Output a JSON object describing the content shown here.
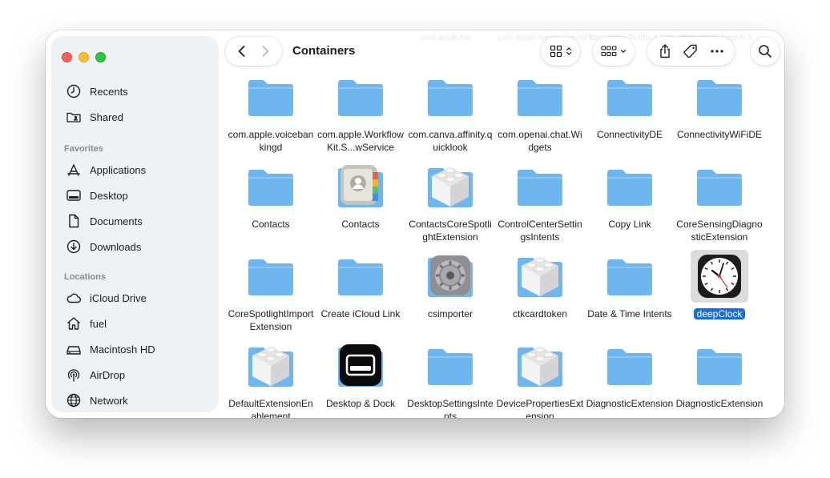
{
  "window": {
    "title": "Containers",
    "accent_color": "#1b6bd9",
    "folder_color": "#6fb6ee"
  },
  "sidebar": {
    "top_items": [
      {
        "label": "Recents",
        "icon": "clock-icon"
      },
      {
        "label": "Shared",
        "icon": "shared-folder-icon"
      }
    ],
    "favorites_heading": "Favorites",
    "favorites": [
      {
        "label": "Applications",
        "icon": "applications-icon"
      },
      {
        "label": "Desktop",
        "icon": "desktop-icon"
      },
      {
        "label": "Documents",
        "icon": "document-icon"
      },
      {
        "label": "Downloads",
        "icon": "download-icon"
      }
    ],
    "locations_heading": "Locations",
    "locations": [
      {
        "label": "iCloud Drive",
        "icon": "cloud-icon"
      },
      {
        "label": "fuel",
        "icon": "home-icon"
      },
      {
        "label": "Macintosh HD",
        "icon": "disk-icon"
      },
      {
        "label": "AirDrop",
        "icon": "airdrop-icon"
      },
      {
        "label": "Network",
        "icon": "globe-icon"
      }
    ]
  },
  "toolbar": {
    "ghost_names": [
      "com.apple.me",
      "com.apple.speec...rverXPC",
      "com.apple.TextIngit.Ser...stension",
      "com.apple.fpeech.S"
    ]
  },
  "files": [
    {
      "name": "com.apple.voicebankingd",
      "kind": "folder"
    },
    {
      "name": "com.apple.WorkflowKit.S...wService",
      "kind": "folder"
    },
    {
      "name": "com.canva.affinity.quicklook",
      "kind": "folder"
    },
    {
      "name": "com.openai.chat.Widgets",
      "kind": "folder"
    },
    {
      "name": "ConnectivityDE",
      "kind": "folder"
    },
    {
      "name": "ConnectivityWiFiDE",
      "kind": "folder"
    },
    {
      "name": "Contacts",
      "kind": "folder"
    },
    {
      "name": "Contacts",
      "kind": "contacts-app"
    },
    {
      "name": "ContactsCoreSpotlightExtension",
      "kind": "extension"
    },
    {
      "name": "ControlCenterSettingsIntents",
      "kind": "folder"
    },
    {
      "name": "Copy Link",
      "kind": "folder"
    },
    {
      "name": "CoreSensingDiagnosticExtension",
      "kind": "folder"
    },
    {
      "name": "CoreSpotlightImportExtension",
      "kind": "folder"
    },
    {
      "name": "Create iCloud Link",
      "kind": "folder"
    },
    {
      "name": "csimporter",
      "kind": "settings-gear"
    },
    {
      "name": "ctkcardtoken",
      "kind": "extension"
    },
    {
      "name": "Date & Time Intents",
      "kind": "folder"
    },
    {
      "name": "deepClock",
      "kind": "clock-app",
      "selected": true
    },
    {
      "name": "DefaultExtensionEnablement",
      "kind": "extension"
    },
    {
      "name": "Desktop & Dock",
      "kind": "dock-app"
    },
    {
      "name": "DesktopSettingsIntents",
      "kind": "folder"
    },
    {
      "name": "DevicePropertiesExtension",
      "kind": "extension"
    },
    {
      "name": "DiagnosticExtension",
      "kind": "folder"
    },
    {
      "name": "DiagnosticExtension",
      "kind": "folder"
    }
  ]
}
